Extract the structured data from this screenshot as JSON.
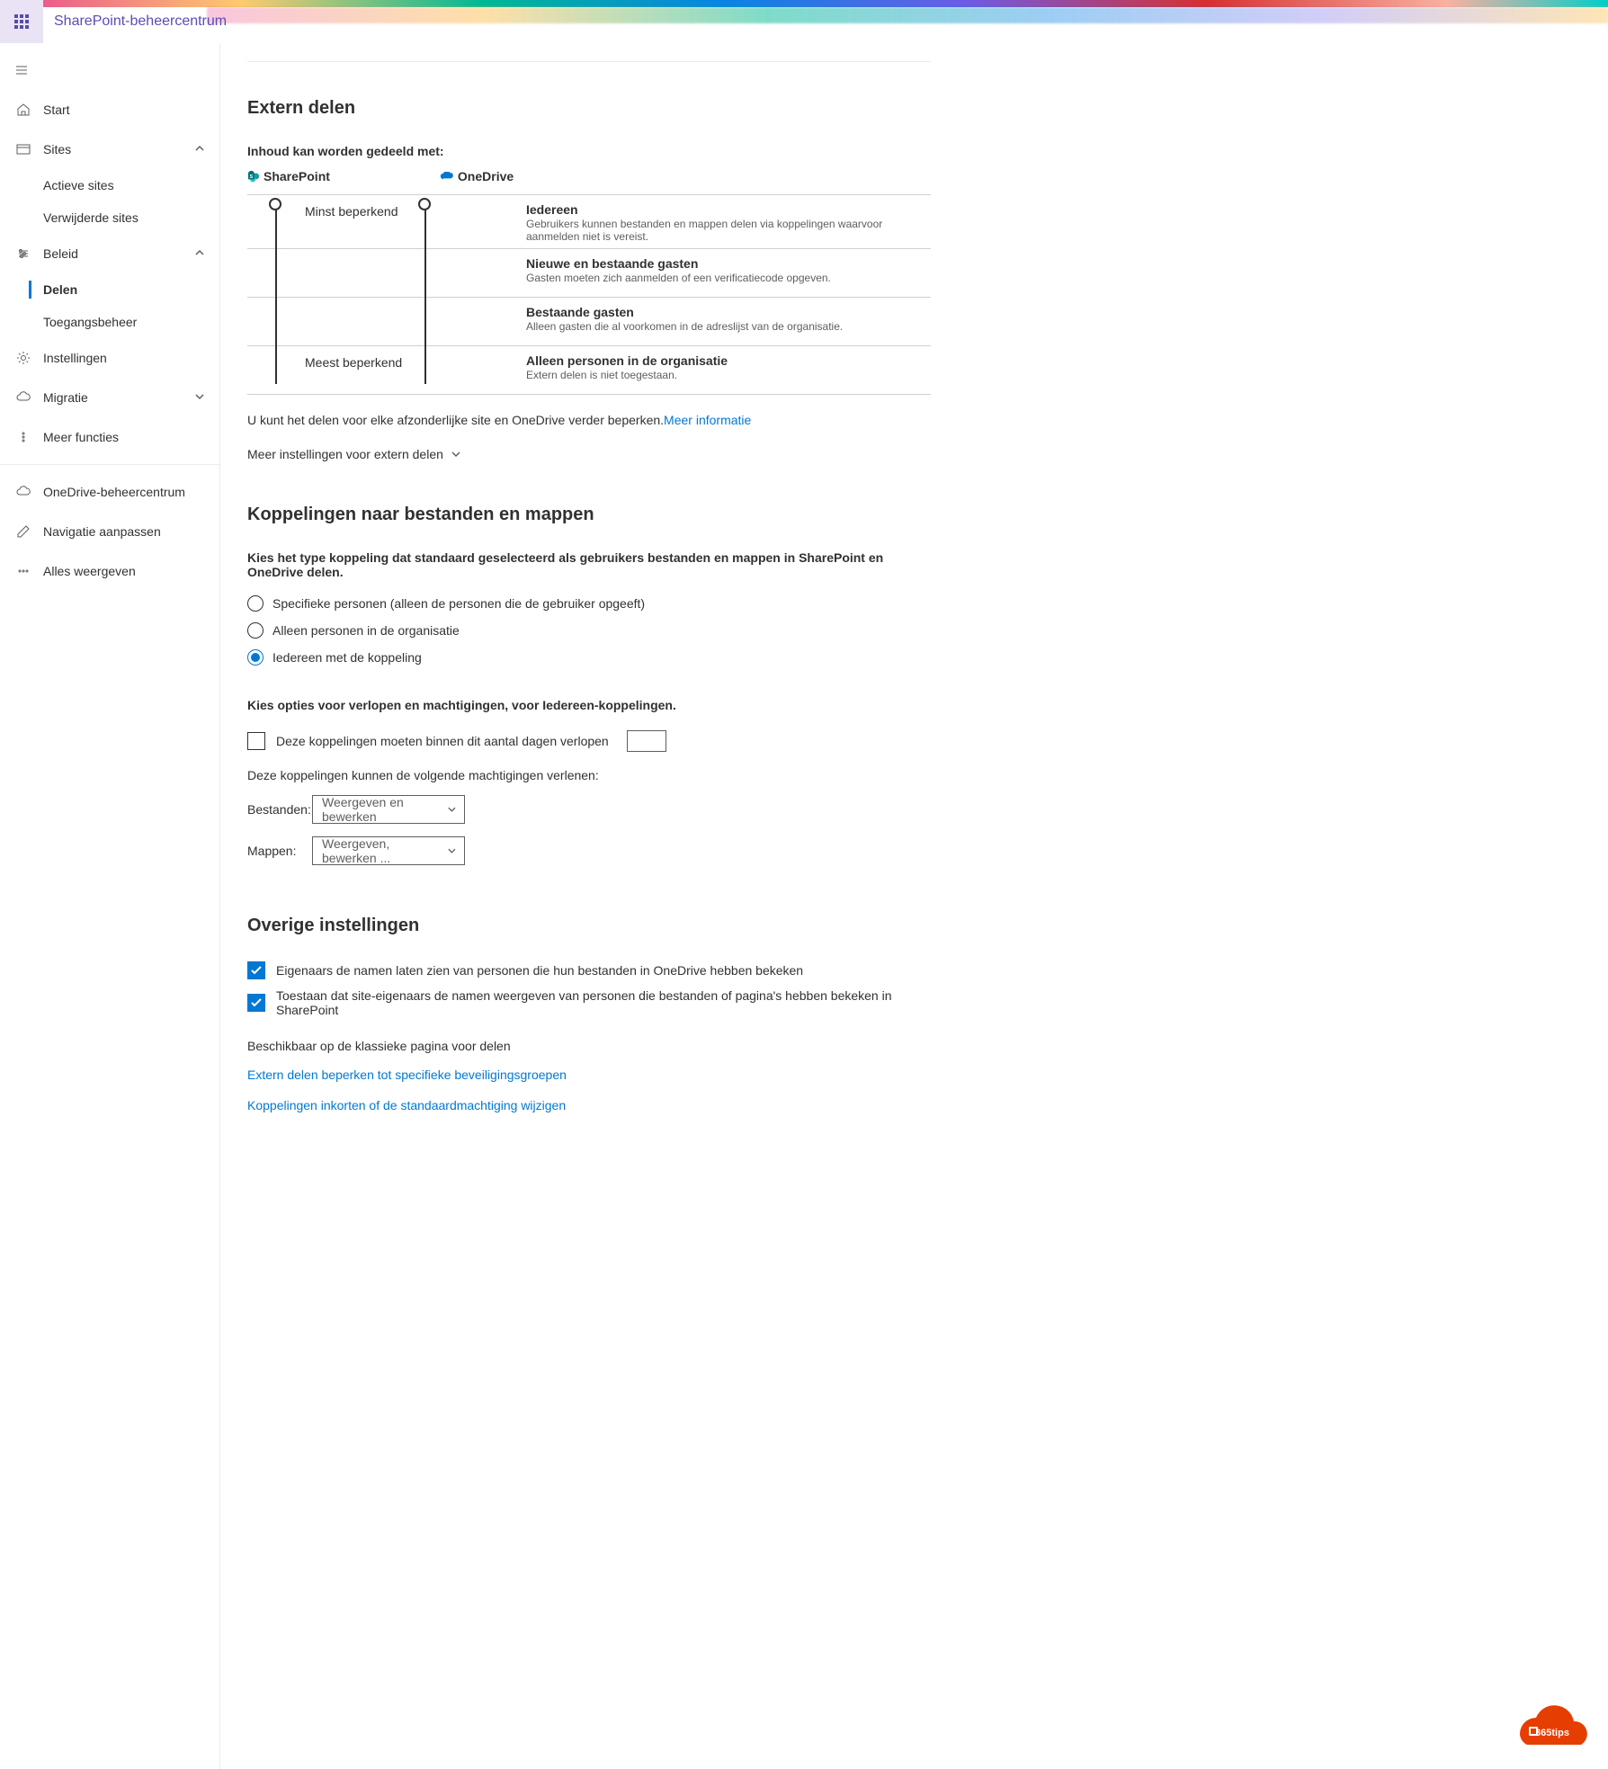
{
  "header": {
    "appTitle": "SharePoint-beheercentrum"
  },
  "sidebar": {
    "start": "Start",
    "sites": "Sites",
    "activeSites": "Actieve sites",
    "deletedSites": "Verwijderde sites",
    "policies": "Beleid",
    "sharing": "Delen",
    "access": "Toegangsbeheer",
    "settings": "Instellingen",
    "migration": "Migratie",
    "moreFeatures": "Meer functies",
    "onedriveAdmin": "OneDrive-beheercentrum",
    "customizeNav": "Navigatie aanpassen",
    "showAll": "Alles weergeven"
  },
  "external": {
    "heading": "Extern delen",
    "canShareWith": "Inhoud kan worden gedeeld met:",
    "sharepoint": "SharePoint",
    "onedrive": "OneDrive",
    "leastRestrictive": "Minst beperkend",
    "mostRestrictive": "Meest beperkend",
    "levels": [
      {
        "title": "Iedereen",
        "desc": "Gebruikers kunnen bestanden en mappen delen via koppelingen waarvoor aanmelden niet is vereist."
      },
      {
        "title": "Nieuwe en bestaande gasten",
        "desc": "Gasten moeten zich aanmelden of een verificatiecode opgeven."
      },
      {
        "title": "Bestaande gasten",
        "desc": "Alleen gasten die al voorkomen in de adreslijst van de organisatie."
      },
      {
        "title": "Alleen personen in de organisatie",
        "desc": "Extern delen is niet toegestaan."
      }
    ],
    "restrictText": "U kunt het delen voor elke afzonderlijke site en OneDrive verder beperken.",
    "moreInfo": "Meer informatie",
    "moreSettings": "Meer instellingen voor extern delen"
  },
  "links": {
    "heading": "Koppelingen naar bestanden en mappen",
    "desc": "Kies het type koppeling dat standaard geselecteerd als gebruikers bestanden en mappen in SharePoint en OneDrive delen.",
    "options": {
      "specific": "Specifieke personen (alleen de personen die de gebruiker opgeeft)",
      "orgOnly": "Alleen personen in de organisatie",
      "anyone": "Iedereen met de koppeling"
    },
    "expiryHeading": "Kies opties voor verlopen en machtigingen, voor Iedereen-koppelingen.",
    "expireCheckbox": "Deze koppelingen moeten binnen dit aantal dagen verlopen",
    "permsText": "Deze koppelingen kunnen de volgende machtigingen verlenen:",
    "filesLabel": "Bestanden:",
    "filesValue": "Weergeven en bewerken",
    "foldersLabel": "Mappen:",
    "foldersValue": "Weergeven, bewerken ..."
  },
  "other": {
    "heading": "Overige instellingen",
    "ownersOnedrive": "Eigenaars de namen laten zien van personen die hun bestanden in OneDrive hebben bekeken",
    "ownersSharepoint": "Toestaan dat site-eigenaars de namen weergeven van personen die bestanden of pagina's hebben bekeken in SharePoint",
    "classicPage": "Beschikbaar op de klassieke pagina voor delen",
    "restrictGroups": "Extern delen beperken tot specifieke beveiligingsgroepen",
    "shortenLinks": "Koppelingen inkorten of de standaardmachtiging wijzigen"
  },
  "badge": {
    "text": "365tips"
  }
}
